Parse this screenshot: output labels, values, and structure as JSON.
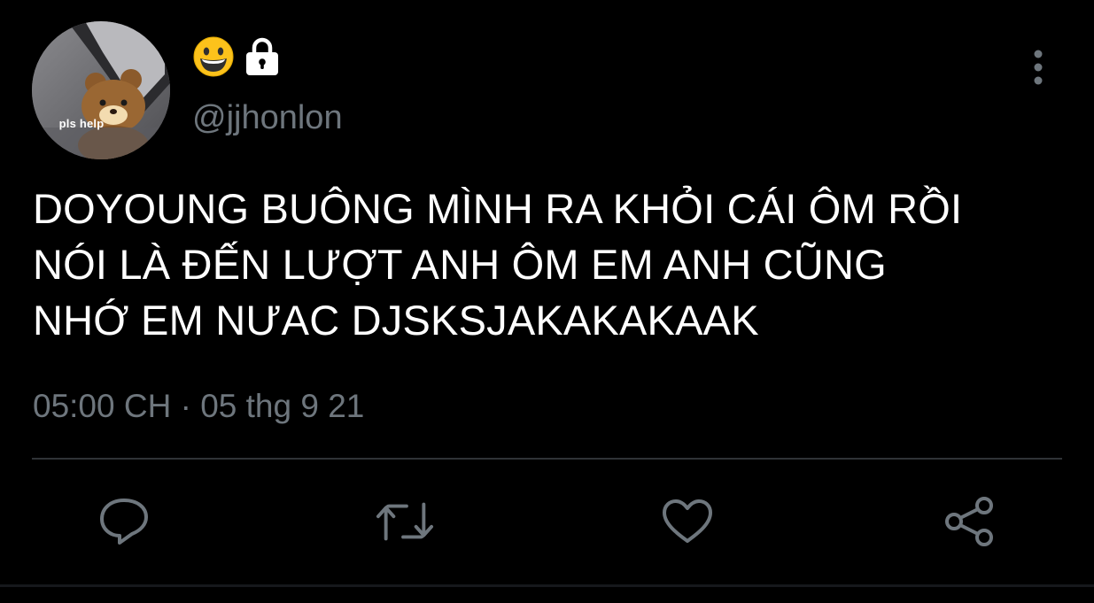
{
  "user": {
    "name_emoji": "😀",
    "protected": true,
    "handle": "@jjhonlon",
    "avatar_caption": "pls help"
  },
  "tweet": {
    "text": "DOYOUNG BUÔNG MÌNH RA KHỎI CÁI ÔM RỒI\nNÓI LÀ ĐẾN LƯỢT ANH ÔM EM ANH CŨNG\nNHỚ EM NƯAC DJSKSJAKAKAKAAK",
    "timestamp": "05:00 CH · 05 thg 9 21"
  },
  "actions": {
    "reply_icon": "reply-icon",
    "retweet_icon": "retweet-icon",
    "like_icon": "heart-icon",
    "share_icon": "share-icon"
  },
  "colors": {
    "background": "#000000",
    "text": "#ffffff",
    "secondary": "#6e767d",
    "divider": "#2f3336"
  }
}
